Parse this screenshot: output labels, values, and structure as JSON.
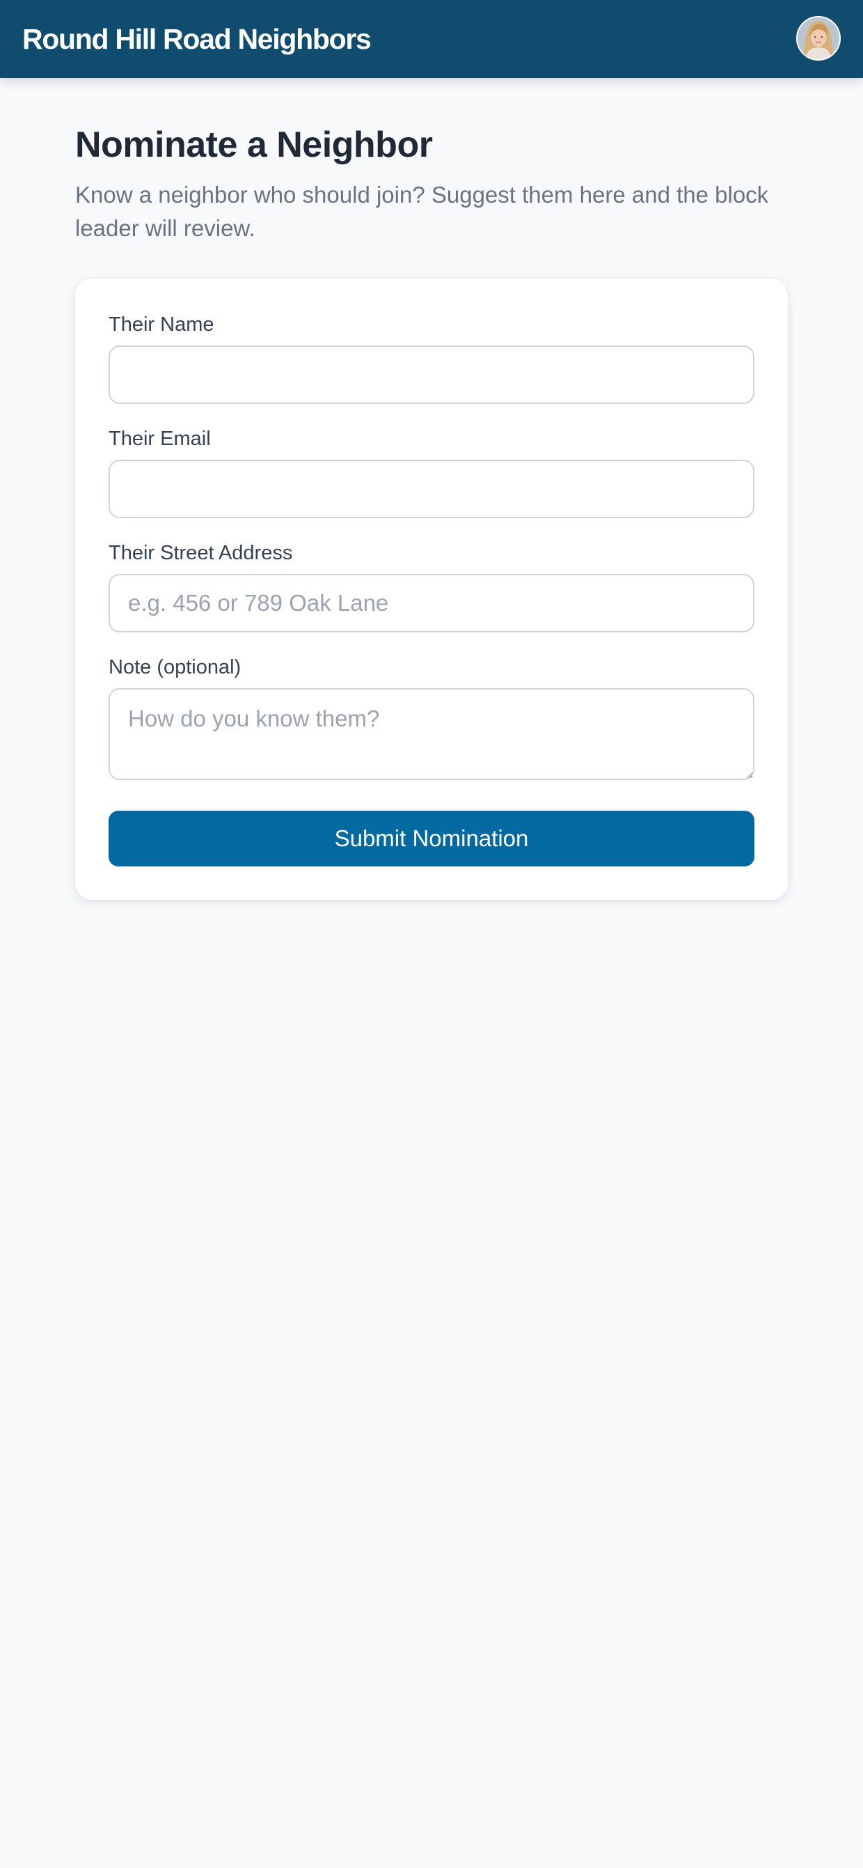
{
  "header": {
    "title": "Round Hill Road Neighbors",
    "avatar_icon": "user-avatar-photo",
    "background_color": "#0f4c6e"
  },
  "page": {
    "title": "Nominate a Neighbor",
    "intro": "Know a neighbor who should join? Suggest them here and the block leader will review."
  },
  "form": {
    "name": {
      "label": "Their Name",
      "value": "",
      "placeholder": ""
    },
    "email": {
      "label": "Their Email",
      "value": "",
      "placeholder": ""
    },
    "address": {
      "label": "Their Street Address",
      "value": "",
      "placeholder": "e.g. 456 or 789 Oak Lane"
    },
    "note": {
      "label": "Note (optional)",
      "value": "",
      "placeholder": "How do you know them?"
    },
    "submit_label": "Submit Nomination",
    "accent_color": "#0369a1"
  }
}
